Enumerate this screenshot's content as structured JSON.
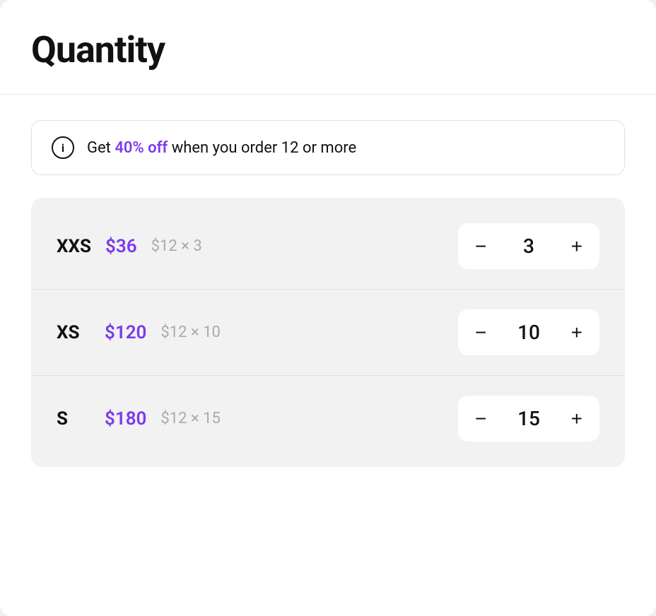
{
  "header": {
    "title": "Quantity"
  },
  "promo": {
    "icon_label": "i",
    "text_before": "Get ",
    "highlight": "40% off",
    "text_after": " when you order 12 or more"
  },
  "sizes": [
    {
      "label": "XXS",
      "price_total": "$36",
      "price_unit": "$12",
      "multiplier": "×",
      "quantity": "3"
    },
    {
      "label": "XS",
      "price_total": "$120",
      "price_unit": "$12",
      "multiplier": "×",
      "quantity": "10"
    },
    {
      "label": "S",
      "price_total": "$180",
      "price_unit": "$12",
      "multiplier": "×",
      "quantity": "15"
    }
  ],
  "stepper": {
    "minus_label": "−",
    "plus_label": "+"
  },
  "colors": {
    "accent": "#7c3aed",
    "muted": "#aaaaaa"
  }
}
